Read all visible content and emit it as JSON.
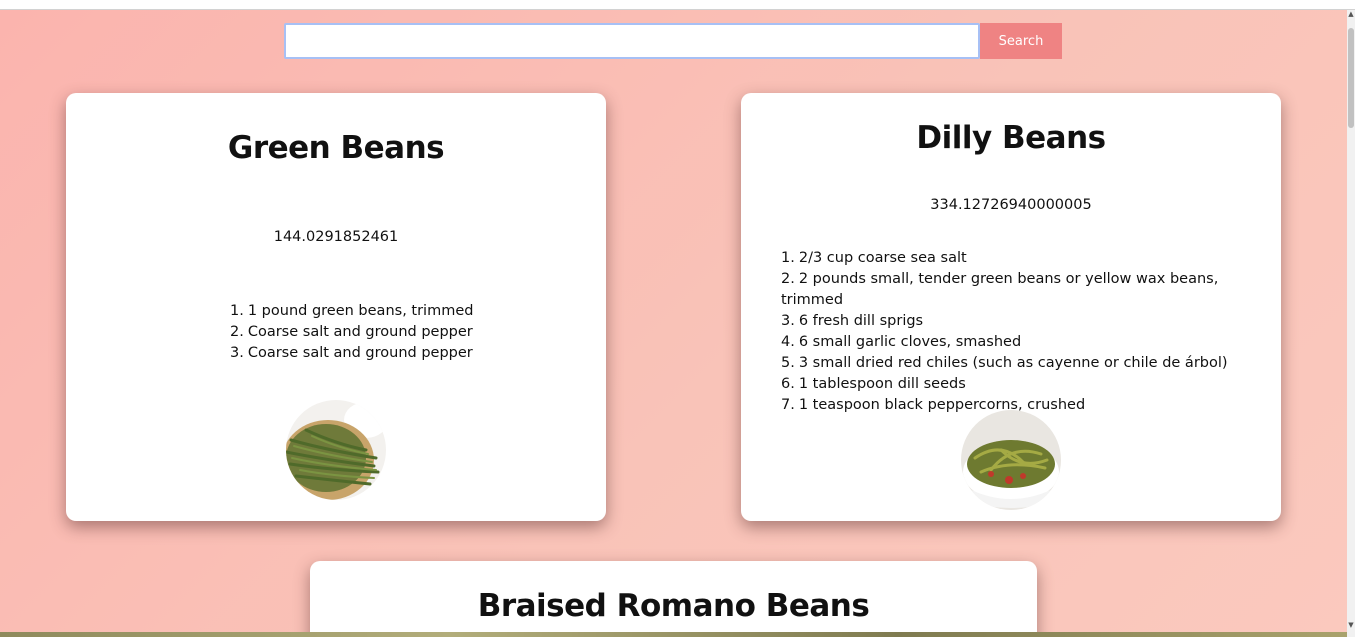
{
  "search": {
    "placeholder": "",
    "value": "",
    "button_label": "Search"
  },
  "recipes": [
    {
      "title": "Green Beans",
      "calories": "144.0291852461",
      "ingredients": [
        {
          "n": "1.",
          "text": "1 pound green beans, trimmed"
        },
        {
          "n": "2.",
          "text": "Coarse salt and ground pepper"
        },
        {
          "n": "3.",
          "text": "Coarse salt and ground pepper"
        }
      ]
    },
    {
      "title": "Dilly Beans",
      "calories": "334.12726940000005",
      "ingredients": [
        {
          "n": "1.",
          "text": "2/3 cup coarse sea salt"
        },
        {
          "n": "2.",
          "text": "2 pounds small, tender green beans or yellow wax beans, trimmed"
        },
        {
          "n": "3.",
          "text": "6 fresh dill sprigs"
        },
        {
          "n": "4.",
          "text": "6 small garlic cloves, smashed"
        },
        {
          "n": "5.",
          "text": "3 small dried red chiles (such as cayenne or chile de árbol)"
        },
        {
          "n": "6.",
          "text": "1 tablespoon dill seeds"
        },
        {
          "n": "7.",
          "text": "1 teaspoon black peppercorns, crushed"
        }
      ]
    },
    {
      "title": "Braised Romano Beans"
    }
  ],
  "colors": {
    "background": "#fbb4ae",
    "search_button": "#ef8383",
    "search_border": "#a7c0f5",
    "card": "#ffffff"
  },
  "icons": {
    "scroll_up": "scroll-up-arrow-icon",
    "scroll_down": "scroll-down-arrow-icon"
  }
}
